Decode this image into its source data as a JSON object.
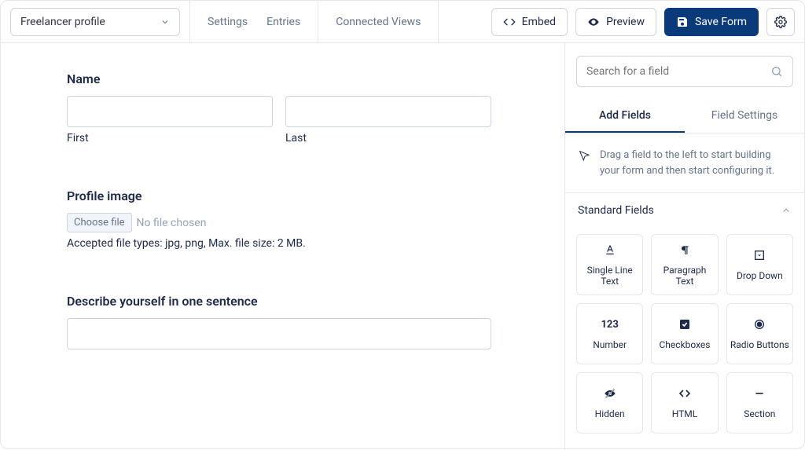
{
  "header": {
    "form_name": "Freelancer profile",
    "nav": {
      "settings": "Settings",
      "entries": "Entries",
      "connected_views": "Connected Views"
    },
    "embed": "Embed",
    "preview": "Preview",
    "save": "Save Form"
  },
  "form": {
    "name": {
      "label": "Name",
      "first_sublabel": "First",
      "last_sublabel": "Last",
      "first_value": "",
      "last_value": ""
    },
    "profile_image": {
      "label": "Profile image",
      "choose_file": "Choose file",
      "no_file": "No file chosen",
      "help": "Accepted file types: jpg, png, Max. file size: 2 MB."
    },
    "describe": {
      "label": "Describe yourself in one sentence",
      "value": ""
    }
  },
  "sidebar": {
    "search_placeholder": "Search for a field",
    "tabs": {
      "add": "Add Fields",
      "settings": "Field Settings"
    },
    "hint": "Drag a field to the left to start building your form and then start configuring it.",
    "section_title": "Standard Fields",
    "fields": {
      "single_line": "Single Line Text",
      "paragraph": "Paragraph Text",
      "dropdown": "Drop Down",
      "number": "Number",
      "checkboxes": "Checkboxes",
      "radio": "Radio Buttons",
      "hidden": "Hidden",
      "html": "HTML",
      "section": "Section"
    }
  }
}
